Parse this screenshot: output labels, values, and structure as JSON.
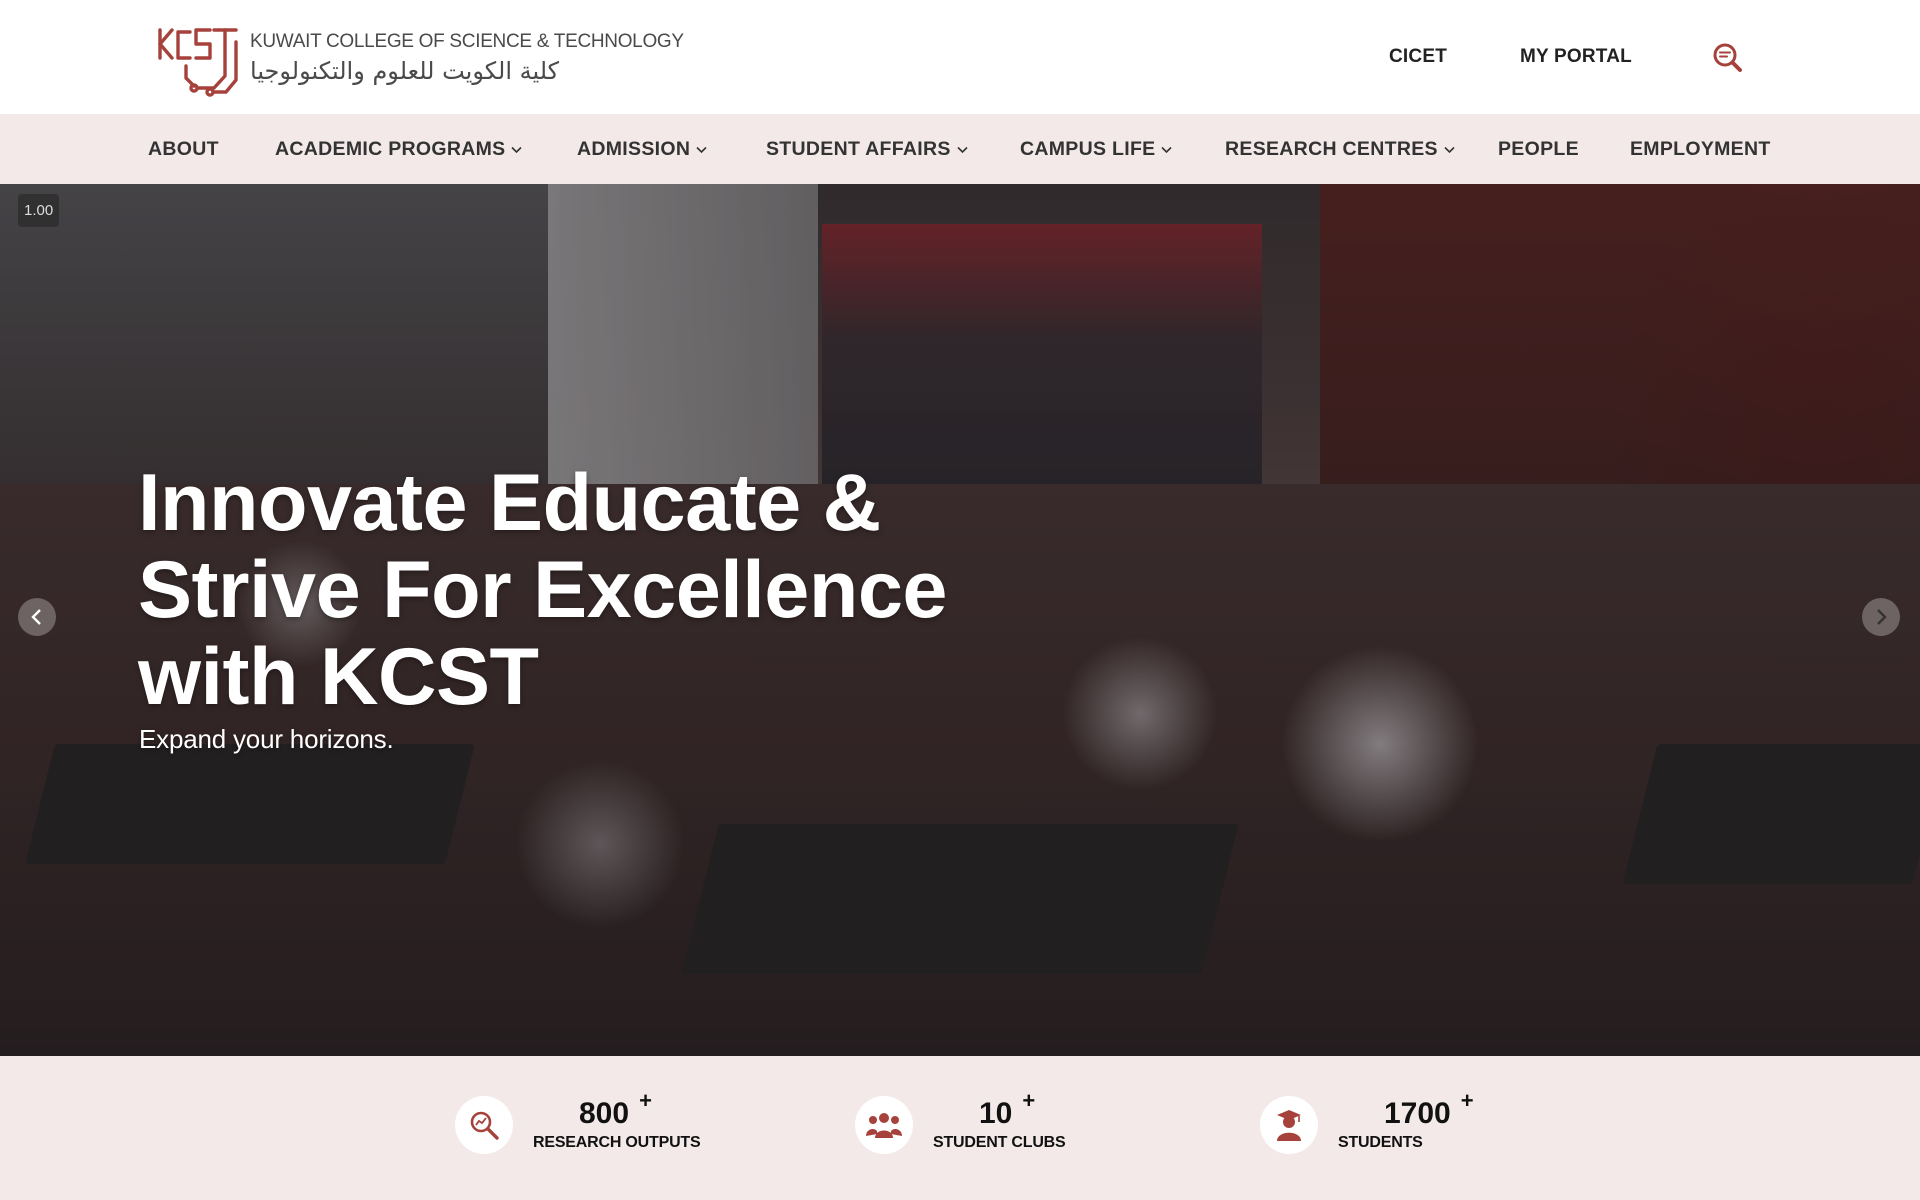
{
  "brand": {
    "logo_mark": "KCST",
    "name_en": "KUWAIT COLLEGE OF SCIENCE & TECHNOLOGY",
    "name_ar": "كلية الكويت للعلوم والتكنولوجيا",
    "accent_color": "#a6423b"
  },
  "header": {
    "links": [
      "CICET",
      "MY PORTAL"
    ],
    "search_icon": "search-icon"
  },
  "nav": {
    "items": [
      {
        "label": "ABOUT",
        "has_dropdown": false
      },
      {
        "label": "ACADEMIC PROGRAMS",
        "has_dropdown": true
      },
      {
        "label": "ADMISSION",
        "has_dropdown": true
      },
      {
        "label": "STUDENT AFFAIRS",
        "has_dropdown": true
      },
      {
        "label": "CAMPUS LIFE",
        "has_dropdown": true
      },
      {
        "label": "RESEARCH CENTRES",
        "has_dropdown": true
      },
      {
        "label": "PEOPLE",
        "has_dropdown": false
      },
      {
        "label": "EMPLOYMENT",
        "has_dropdown": false
      }
    ]
  },
  "hero": {
    "zoom": "1.00",
    "title_lines": [
      "Innovate Educate &",
      "Strive For Excellence",
      "with KCST"
    ],
    "subtitle": "Expand your horizons.",
    "prev_icon": "chevron-left-icon",
    "next_icon": "chevron-right-icon"
  },
  "stats": [
    {
      "value": "800",
      "suffix": "+",
      "label": "RESEARCH OUTPUTS",
      "icon": "research-search-icon"
    },
    {
      "value": "10",
      "suffix": "+",
      "label": "STUDENT CLUBS",
      "icon": "group-icon"
    },
    {
      "value": "1700",
      "suffix": "+",
      "label": "STUDENTS",
      "icon": "graduate-icon"
    }
  ]
}
